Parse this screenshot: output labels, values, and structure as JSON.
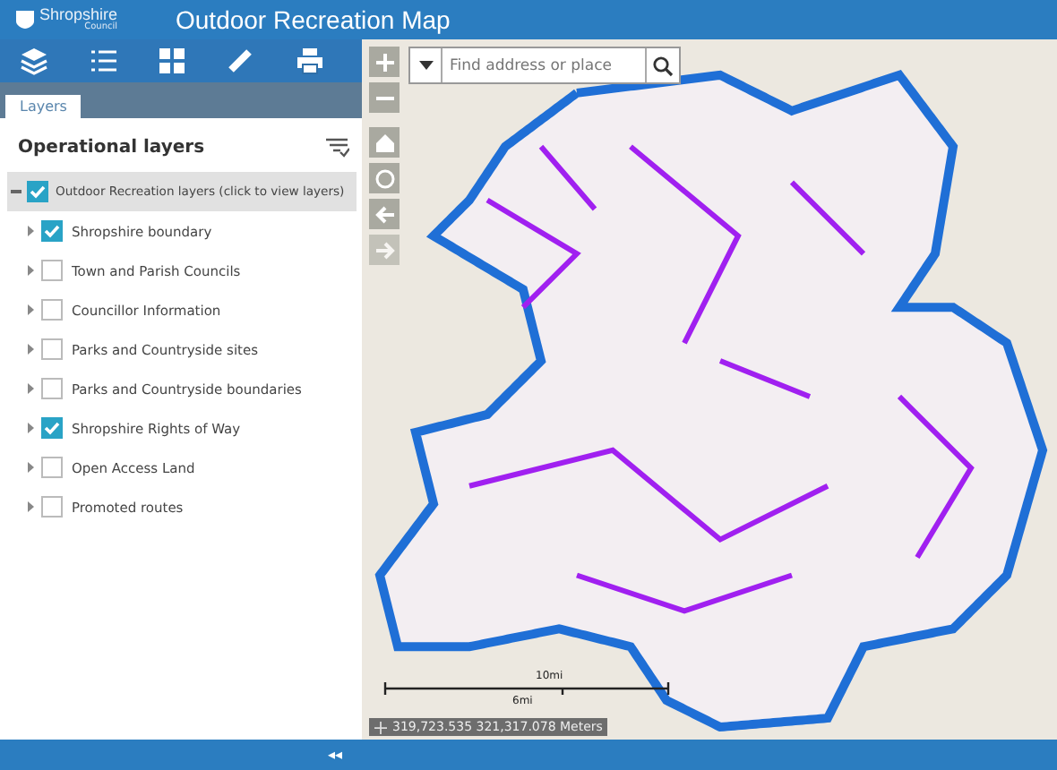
{
  "header": {
    "logo": "Shropshire",
    "logo_sub": "Council",
    "title": "Outdoor Recreation Map"
  },
  "panel": {
    "tab": {
      "label": "Layers",
      "selected": true
    },
    "heading": "Operational layers",
    "group": {
      "label": "Outdoor Recreation layers (click to view layers)",
      "checked": true,
      "expanded": true,
      "children": [
        {
          "label": "Shropshire boundary",
          "checked": true
        },
        {
          "label": "Town and Parish Councils",
          "checked": false
        },
        {
          "label": "Councillor Information",
          "checked": false
        },
        {
          "label": "Parks and Countryside sites",
          "checked": false
        },
        {
          "label": "Parks and Countryside boundaries",
          "checked": false
        },
        {
          "label": "Shropshire Rights of Way",
          "checked": true
        },
        {
          "label": "Open Access Land",
          "checked": false
        },
        {
          "label": "Promoted routes",
          "checked": false
        }
      ]
    }
  },
  "map": {
    "search": {
      "placeholder": "Find address or place"
    },
    "scale": {
      "top": "10mi",
      "bottom": "6mi"
    },
    "coordinates": "319,723.535 321,317.078 Meters"
  },
  "footer": {
    "collapse": "◂◂"
  }
}
